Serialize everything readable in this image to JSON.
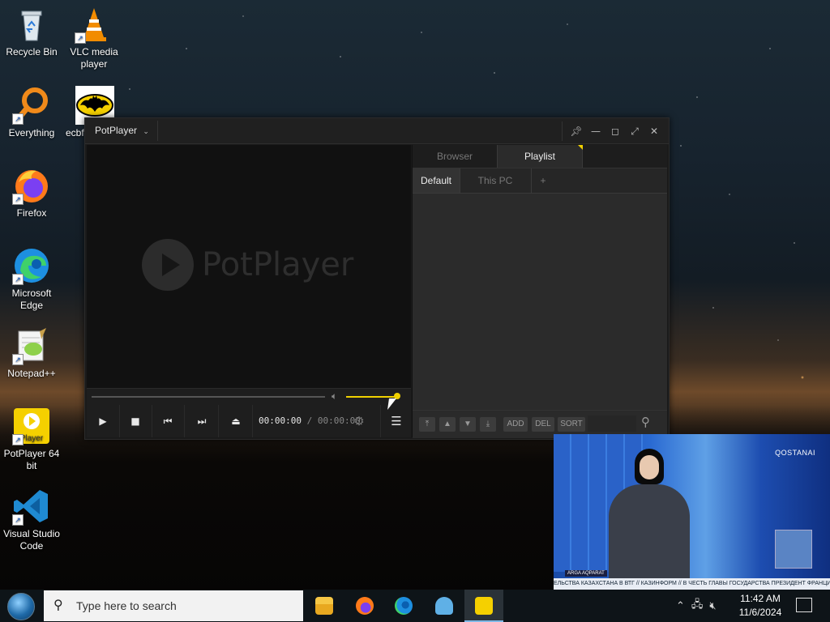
{
  "desktop": {
    "icons": [
      {
        "label": "Recycle Bin",
        "icon": "recycle-bin-icon"
      },
      {
        "label": "VLC media player",
        "icon": "vlc-cone-icon"
      },
      {
        "label": "Everything",
        "icon": "magnifier-icon"
      },
      {
        "label": "ecbf",
        "icon": "batman-icon"
      },
      {
        "label": "Firefox",
        "icon": "firefox-icon"
      },
      {
        "label": "Microsoft Edge",
        "icon": "edge-icon"
      },
      {
        "label": "Notepad++",
        "icon": "notepadpp-icon"
      },
      {
        "label": "PotPlayer 64 bit",
        "icon": "potplayer-icon"
      },
      {
        "label": "Visual Studio Code",
        "icon": "vscode-icon"
      }
    ]
  },
  "potplayer": {
    "menu_label": "PotPlayer",
    "logo_text": "PotPlayer",
    "time_current": "00:00:00",
    "time_separator": "/",
    "time_total": "00:00:00",
    "volume_fraction": 0.95,
    "seek_fraction": 0,
    "tabs_top": [
      "Browser",
      "Playlist"
    ],
    "active_top_tab": "Playlist",
    "tabs_sub": [
      "Default",
      "This PC",
      "+"
    ],
    "active_sub_tab": "Default",
    "playlist_buttons": {
      "add": "ADD",
      "del": "DEL",
      "sort": "SORT"
    }
  },
  "news_overlay": {
    "channel": "QOSTANAI",
    "title_tag": "ARGA AQPARAT",
    "ticker": "ЕЛЬСТВА КАЗАХСТАНА В ВТГ  //  КАЗИНФОРМ  //  В ЧЕСТЬ ГЛАВЫ ГОСУДАРСТВА ПРЕЗИДЕНТ ФРАНЦИИ ДАЛ"
  },
  "taskbar": {
    "search_placeholder": "Type here to search",
    "pinned": [
      "file-explorer-icon",
      "firefox-icon",
      "edge-icon",
      "shell-icon",
      "potplayer-icon"
    ],
    "active_app": "potplayer-icon",
    "time": "11:42 AM",
    "date": "11/6/2024"
  },
  "colors": {
    "accent_yellow": "#f0d000",
    "player_bg": "#1a1a1a",
    "panel_bg": "#2a2a2a"
  }
}
